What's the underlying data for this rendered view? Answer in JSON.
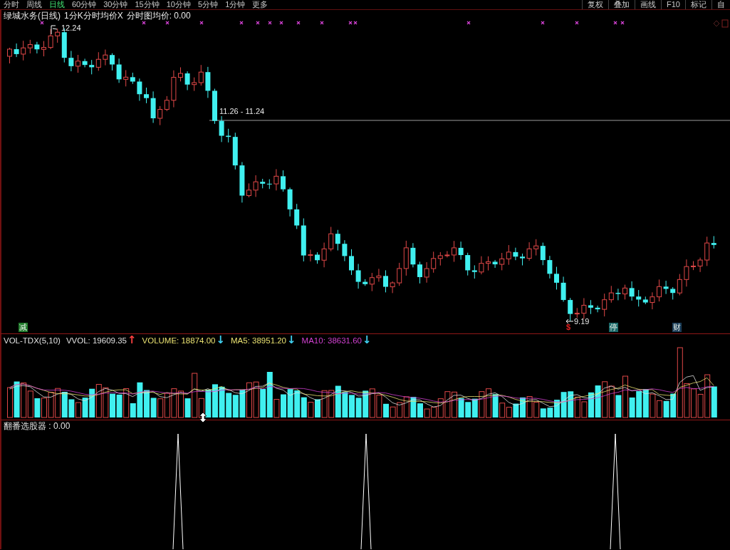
{
  "toolbar": {
    "period_tabs": [
      {
        "label": "分时",
        "selected": false
      },
      {
        "label": "周线",
        "selected": false
      },
      {
        "label": "日线",
        "selected": true
      },
      {
        "label": "60分钟",
        "selected": false
      },
      {
        "label": "30分钟",
        "selected": false
      },
      {
        "label": "15分钟",
        "selected": false
      },
      {
        "label": "10分钟",
        "selected": false
      },
      {
        "label": "5分钟",
        "selected": false
      },
      {
        "label": "1分钟",
        "selected": false
      },
      {
        "label": "更多",
        "selected": false
      }
    ],
    "tools": [
      "复权",
      "叠加",
      "画线",
      "F10",
      "标记",
      "自"
    ]
  },
  "main_chart": {
    "title": "绿城水务(日线)",
    "legend": [
      "1分K分时均价X",
      "分时图均价: 0.00"
    ],
    "high_label": "12.24",
    "low_label": "9.19",
    "range_label": "11.26 - 11.24",
    "signals": [
      {
        "label": "减",
        "kind": "badge",
        "color": "#1f7a2a"
      },
      {
        "label": "$",
        "kind": "plain",
        "color": "#e02020"
      },
      {
        "label": "停",
        "kind": "badge",
        "color": "#1b6a6a"
      },
      {
        "label": "财",
        "kind": "badge",
        "color": "#1d3f5a"
      }
    ]
  },
  "volume_panel": {
    "items": [
      {
        "text": "VOL-TDX(5,10)",
        "color": "#e0e0e0"
      },
      {
        "text": "VVOL: 19609.35",
        "color": "#e0e0e0",
        "arrow": {
          "text": "↑",
          "color": "#ff4040"
        }
      },
      {
        "text": "VOLUME: 18874.00",
        "color": "#e8e070",
        "arrow": {
          "text": "↓",
          "color": "#40d0f0"
        }
      },
      {
        "text": "MA5: 38951.20",
        "color": "#e8e070",
        "arrow": {
          "text": "↓",
          "color": "#40d0f0"
        }
      },
      {
        "text": "MA10: 38631.60",
        "color": "#d040d0",
        "arrow": {
          "text": "↓",
          "color": "#40d0f0"
        }
      }
    ]
  },
  "indicator_panel": {
    "label": "翻番选股器 : 0.00"
  }
}
